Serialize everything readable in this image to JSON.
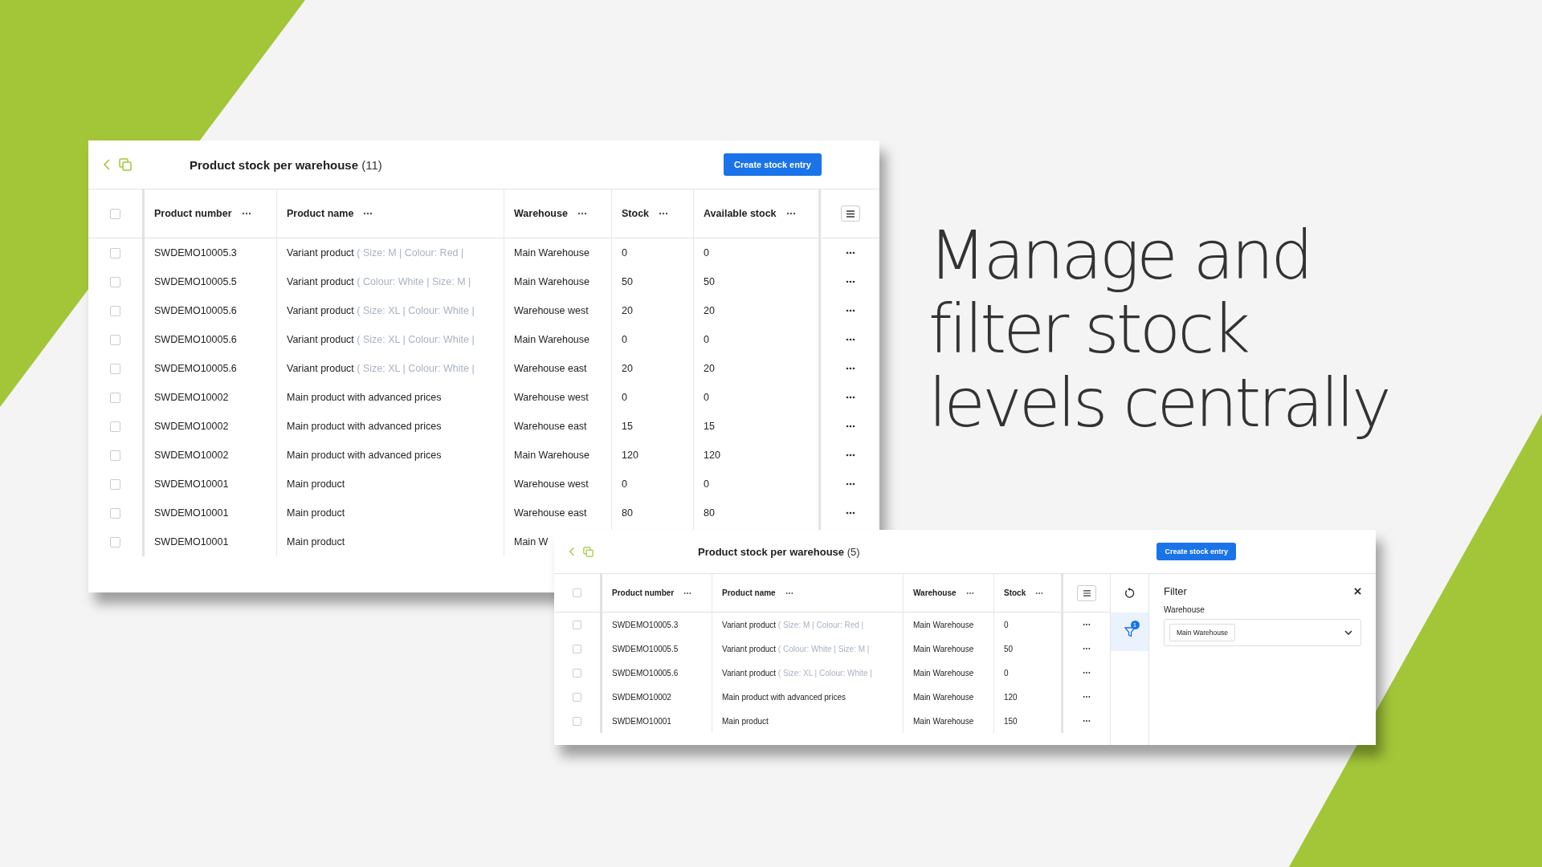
{
  "headline": [
    "Manage and",
    "filter stock",
    "levels centrally"
  ],
  "main_panel": {
    "title": "Product stock per warehouse",
    "count": "(11)",
    "create_button": "Create stock entry",
    "columns": [
      "Product number",
      "Product name",
      "Warehouse",
      "Stock",
      "Available stock"
    ],
    "all_checked": false,
    "rows": [
      {
        "checked": false,
        "number": "SWDEMO10005.3",
        "name": "Variant product",
        "variant": "( Size: M | Colour: Red |",
        "warehouse": "Main Warehouse",
        "stock": "0",
        "available": "0"
      },
      {
        "checked": false,
        "number": "SWDEMO10005.5",
        "name": "Variant product",
        "variant": "( Colour: White | Size: M |",
        "warehouse": "Main Warehouse",
        "stock": "50",
        "available": "50"
      },
      {
        "checked": false,
        "number": "SWDEMO10005.6",
        "name": "Variant product",
        "variant": "( Size: XL | Colour: White |",
        "warehouse": "Warehouse west",
        "stock": "20",
        "available": "20"
      },
      {
        "checked": false,
        "number": "SWDEMO10005.6",
        "name": "Variant product",
        "variant": "( Size: XL | Colour: White |",
        "warehouse": "Main Warehouse",
        "stock": "0",
        "available": "0"
      },
      {
        "checked": false,
        "number": "SWDEMO10005.6",
        "name": "Variant product",
        "variant": "( Size: XL | Colour: White |",
        "warehouse": "Warehouse east",
        "stock": "20",
        "available": "20"
      },
      {
        "checked": false,
        "number": "SWDEMO10002",
        "name": "Main product with advanced prices",
        "warehouse": "Warehouse west",
        "stock": "0",
        "available": "0"
      },
      {
        "checked": false,
        "number": "SWDEMO10002",
        "name": "Main product with advanced prices",
        "warehouse": "Warehouse east",
        "stock": "15",
        "available": "15"
      },
      {
        "checked": false,
        "number": "SWDEMO10002",
        "name": "Main product with advanced prices",
        "warehouse": "Main Warehouse",
        "stock": "120",
        "available": "120"
      },
      {
        "checked": false,
        "number": "SWDEMO10001",
        "name": "Main product",
        "warehouse": "Warehouse west",
        "stock": "0",
        "available": "0"
      },
      {
        "checked": false,
        "number": "SWDEMO10001",
        "name": "Main product",
        "warehouse": "Warehouse east",
        "stock": "80",
        "available": "80"
      },
      {
        "checked": false,
        "number": "SWDEMO10001",
        "name": "Main product",
        "warehouse": "Main W"
      }
    ]
  },
  "filter_panel": {
    "title": "Product stock per warehouse",
    "count": "(5)",
    "create_button": "Create stock entry",
    "columns": [
      "Product number",
      "Product name",
      "Warehouse",
      "Stock"
    ],
    "all_checked": false,
    "rows": [
      {
        "checked": false,
        "number": "SWDEMO10005.3",
        "name": "Variant product",
        "variant": "( Size: M | Colour: Red |",
        "warehouse": "Main Warehouse",
        "stock": "0"
      },
      {
        "checked": false,
        "number": "SWDEMO10005.5",
        "name": "Variant product",
        "variant": "( Colour: White | Size: M |",
        "warehouse": "Main Warehouse",
        "stock": "50"
      },
      {
        "checked": false,
        "number": "SWDEMO10005.6",
        "name": "Variant product",
        "variant": "( Size: XL | Colour: White |",
        "warehouse": "Main Warehouse",
        "stock": "0"
      },
      {
        "checked": false,
        "number": "SWDEMO10002",
        "name": "Main product with advanced prices",
        "warehouse": "Main Warehouse",
        "stock": "120"
      },
      {
        "checked": false,
        "number": "SWDEMO10001",
        "name": "Main product",
        "warehouse": "Main Warehouse",
        "stock": "150"
      }
    ],
    "rail": [
      {
        "kind": "reset",
        "selected": false
      },
      {
        "kind": "filter",
        "selected": true,
        "badge": "1"
      }
    ],
    "filter": {
      "title": "Filter",
      "field_label": "Warehouse",
      "chosen": "Main Warehouse"
    }
  }
}
